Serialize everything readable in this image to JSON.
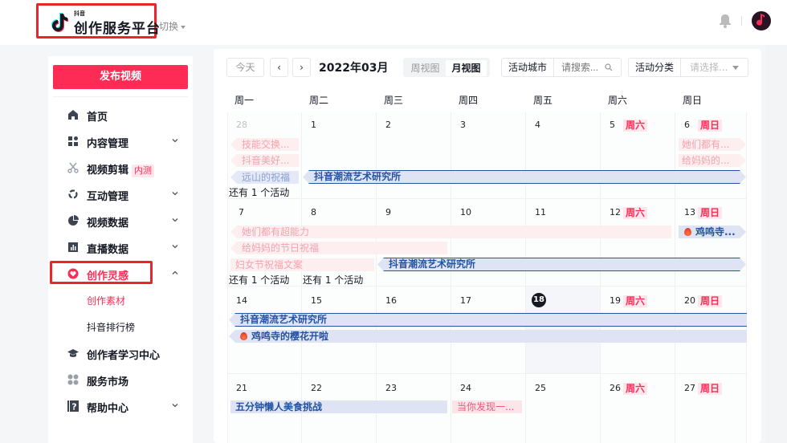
{
  "header": {
    "logo_small": "抖音",
    "logo_title": "创作服务平台",
    "switch_label": "切换",
    "bell_icon": "bell-icon",
    "avatar_icon": "music-note-avatar"
  },
  "sidebar": {
    "publish_label": "发布视频",
    "items": [
      {
        "label": "首页",
        "icon": "home-icon",
        "expandable": false
      },
      {
        "label": "内容管理",
        "icon": "grid-icon",
        "expandable": true
      },
      {
        "label": "视频剪辑",
        "icon": "scissors-icon",
        "expandable": false,
        "badge": "内测"
      },
      {
        "label": "互动管理",
        "icon": "interaction-icon",
        "expandable": true
      },
      {
        "label": "视频数据",
        "icon": "pie-chart-icon",
        "expandable": true
      },
      {
        "label": "直播数据",
        "icon": "bar-chart-icon",
        "expandable": true
      },
      {
        "label": "创作灵感",
        "icon": "heart-icon",
        "expandable": true,
        "expanded": true,
        "active": true
      },
      {
        "label": "创作素材",
        "sub": true,
        "active": true
      },
      {
        "label": "抖音排行榜",
        "sub": true
      },
      {
        "label": "创作者学习中心",
        "icon": "graduation-cap-icon",
        "expandable": false
      },
      {
        "label": "服务市场",
        "icon": "apps-icon",
        "expandable": false
      },
      {
        "label": "帮助中心",
        "icon": "help-icon",
        "expandable": true
      }
    ]
  },
  "toolbar": {
    "today_label": "今天",
    "prev_label": "‹",
    "next_label": "›",
    "month_title": "2022年03月",
    "view_week": "周视图",
    "view_month": "月视图",
    "city_label": "活动城市",
    "city_placeholder": "请搜索...",
    "category_label": "活动分类",
    "category_placeholder": "请选择..."
  },
  "calendar": {
    "weekdays": [
      "周一",
      "周二",
      "周三",
      "周四",
      "周五",
      "周六",
      "周日"
    ],
    "saturday_tag": "周六",
    "sunday_tag": "周日",
    "today": "18",
    "weeks": [
      [
        "28",
        "1",
        "2",
        "3",
        "4",
        "5",
        "6"
      ],
      [
        "7",
        "8",
        "9",
        "10",
        "11",
        "12",
        "13"
      ],
      [
        "14",
        "15",
        "16",
        "17",
        "18",
        "19",
        "20"
      ],
      [
        "21",
        "22",
        "23",
        "24",
        "25",
        "26",
        "27"
      ]
    ],
    "events": {
      "w0": [
        "技能交换...",
        "抖音美好...",
        "远山的祝福",
        "抖音潮流艺术研究所",
        "她们都有...",
        "给妈妈的..."
      ],
      "w1": [
        "她们都有超能力",
        "给妈妈的节日祝福",
        "妇女节祝福文案",
        "抖音潮流艺术研究所",
        "鸡鸣寺..."
      ],
      "w2": [
        "抖音潮流艺术研究所",
        "鸡鸣寺的樱花开啦"
      ],
      "w3": [
        "五分钟懒人美食挑战",
        "当你发现一..."
      ]
    },
    "more_label": "还有 1 个活动"
  }
}
